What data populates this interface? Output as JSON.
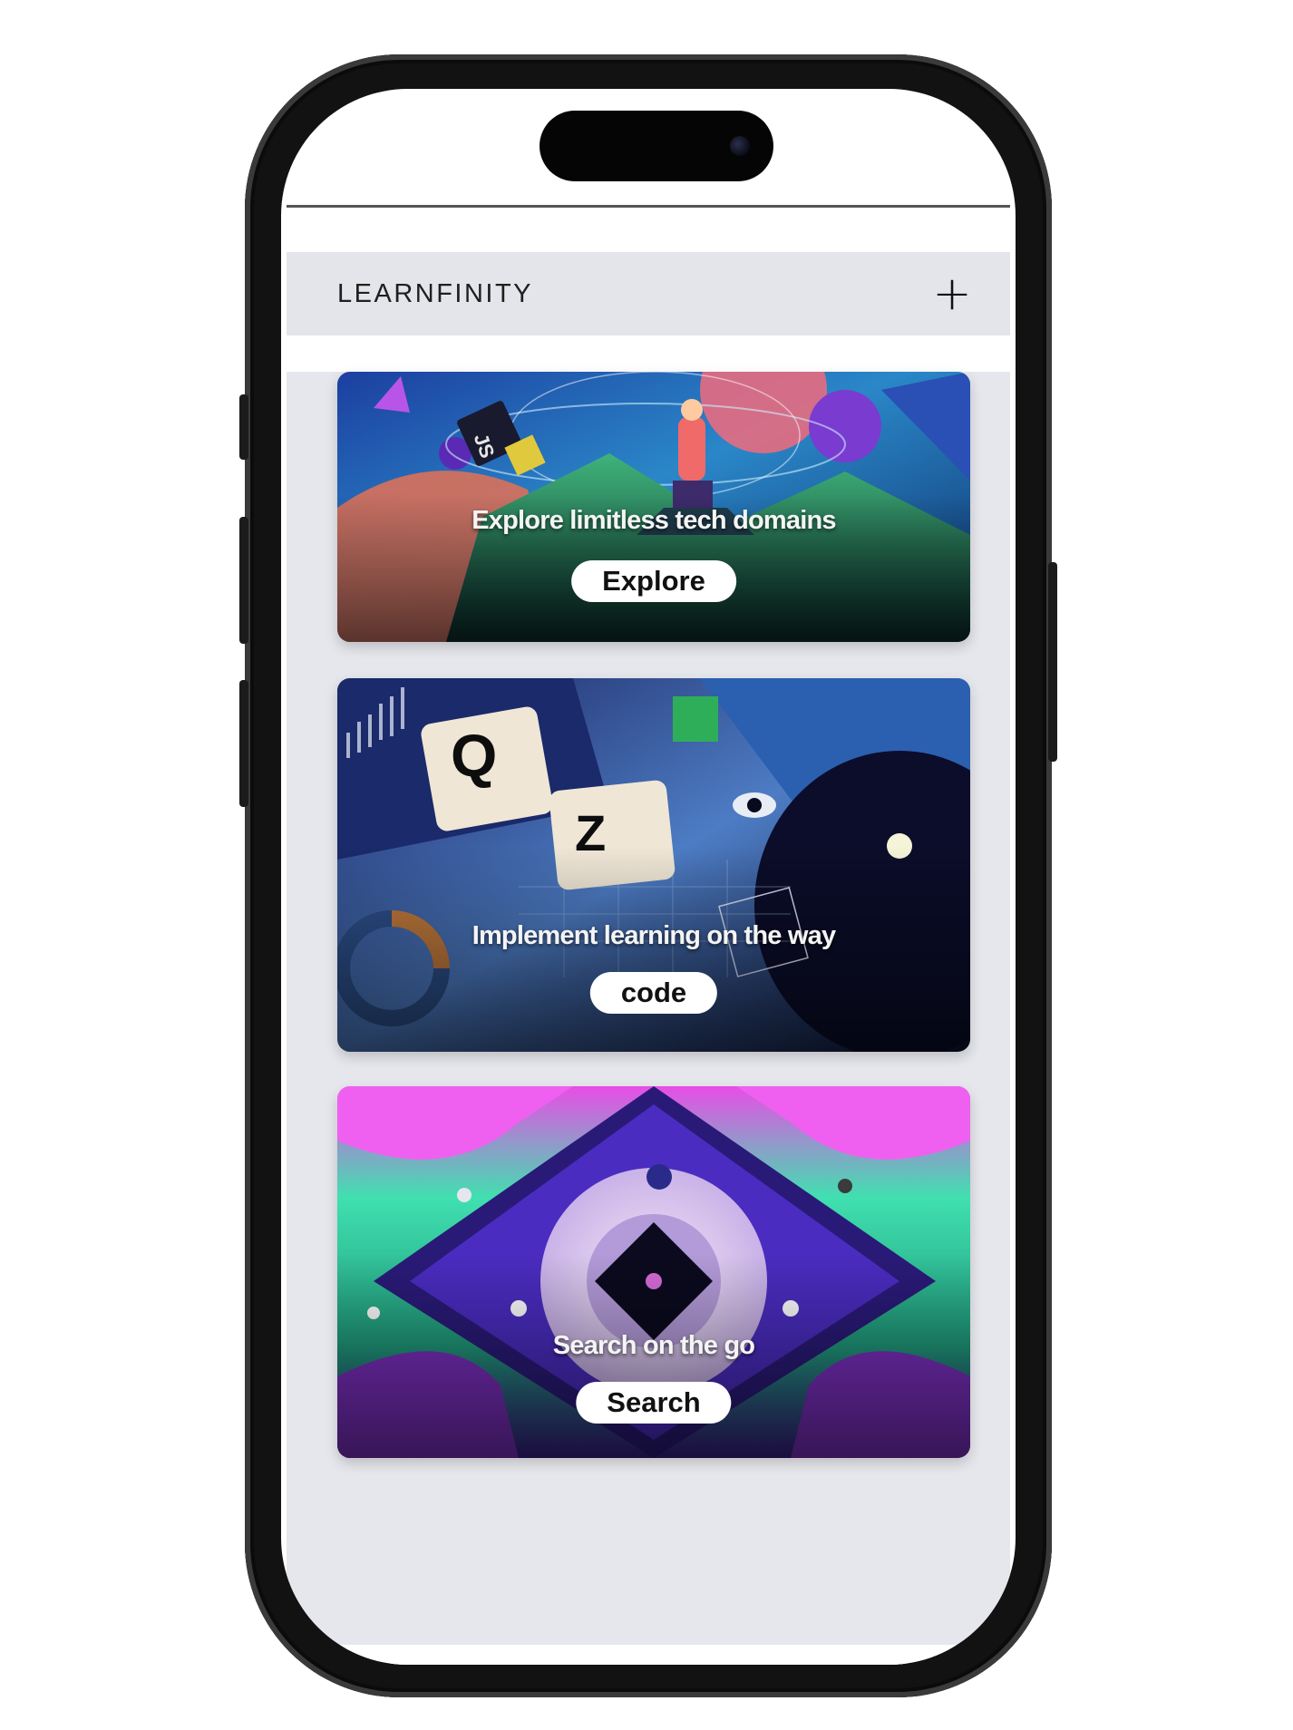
{
  "app": {
    "brand": "LEARNFINITY",
    "add_label": "+"
  },
  "cards": [
    {
      "caption": "Explore limitless tech domains",
      "button_label": "Explore",
      "art_text": "JS"
    },
    {
      "caption": "Implement learning on the way",
      "button_label": "code",
      "art_text": [
        "Q",
        "Z"
      ]
    },
    {
      "caption": "Search on the go",
      "button_label": "Search"
    }
  ],
  "colors": {
    "header_bg": "#e4e5ea",
    "content_bg": "#e6e7ec",
    "phone_frame": "#121212",
    "button_bg": "#ffffff"
  }
}
